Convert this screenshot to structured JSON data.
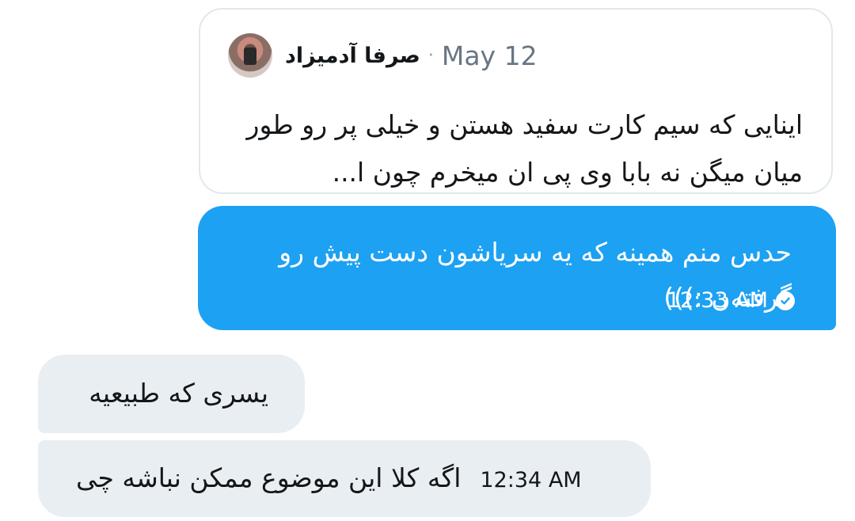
{
  "quote": {
    "author": "صرفا آدمیزاد",
    "separator": "·",
    "date": "May 12",
    "text": "اینایی که سیم کارت سفید هستن و خیلی پر رو طور میان میگن نه بابا وی پی ان میخرم چون ا..."
  },
  "messages": [
    {
      "direction": "outgoing",
      "text": "حدس منم همینه که یه سریاشون دست پیش رو گرفته‌ن :)))",
      "time": "12:33 AM",
      "status_icon": "check-circle-icon"
    },
    {
      "direction": "incoming",
      "text": "یسری که طبیعیه"
    },
    {
      "direction": "incoming",
      "text": "اگه کلا این موضوع ممکن نباشه چی",
      "time": "12:34 AM"
    }
  ],
  "colors": {
    "outgoing_bubble": "#1da1f2",
    "incoming_bubble": "#e9eef2",
    "card_border": "#e1e8ed",
    "secondary_text": "#687684"
  }
}
